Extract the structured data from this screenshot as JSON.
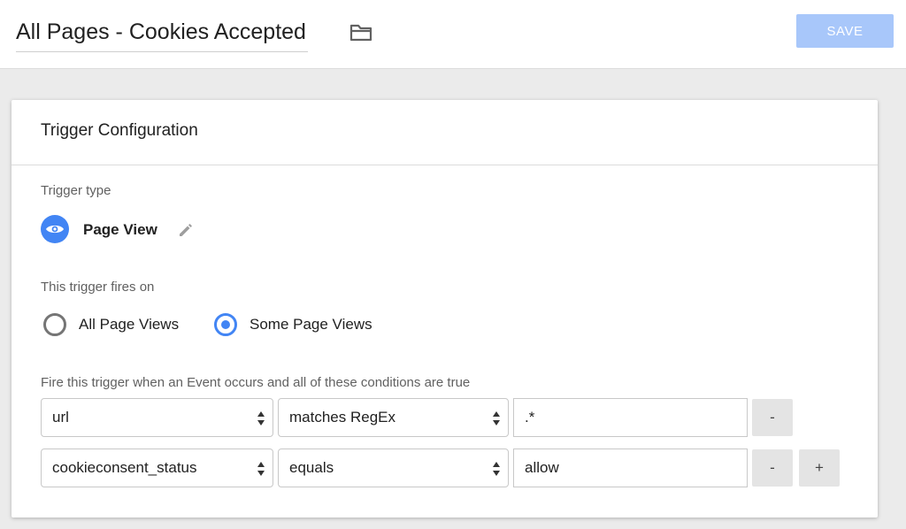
{
  "header": {
    "title": "All Pages - Cookies Accepted",
    "folder_icon": "folder-icon",
    "save_label": "SAVE"
  },
  "card": {
    "title": "Trigger Configuration",
    "trigger_type_label": "Trigger type",
    "trigger_type": {
      "icon": "eye-icon",
      "name": "Page View",
      "edit_icon": "pencil-icon"
    },
    "fires_on_label": "This trigger fires on",
    "fires_on_options": [
      {
        "label": "All Page Views",
        "checked": false
      },
      {
        "label": "Some Page Views",
        "checked": true
      }
    ],
    "conditions_label": "Fire this trigger when an Event occurs and all of these conditions are true",
    "conditions": [
      {
        "variable": "url",
        "operator": "matches RegEx",
        "value": ".*",
        "remove_label": "-",
        "add_label": ""
      },
      {
        "variable": "cookieconsent_status",
        "operator": "equals",
        "value": "allow",
        "remove_label": "-",
        "add_label": "+"
      }
    ]
  },
  "colors": {
    "accent": "#4285f4",
    "save_button": "#a8c7fa",
    "page_background": "#ebebeb"
  }
}
